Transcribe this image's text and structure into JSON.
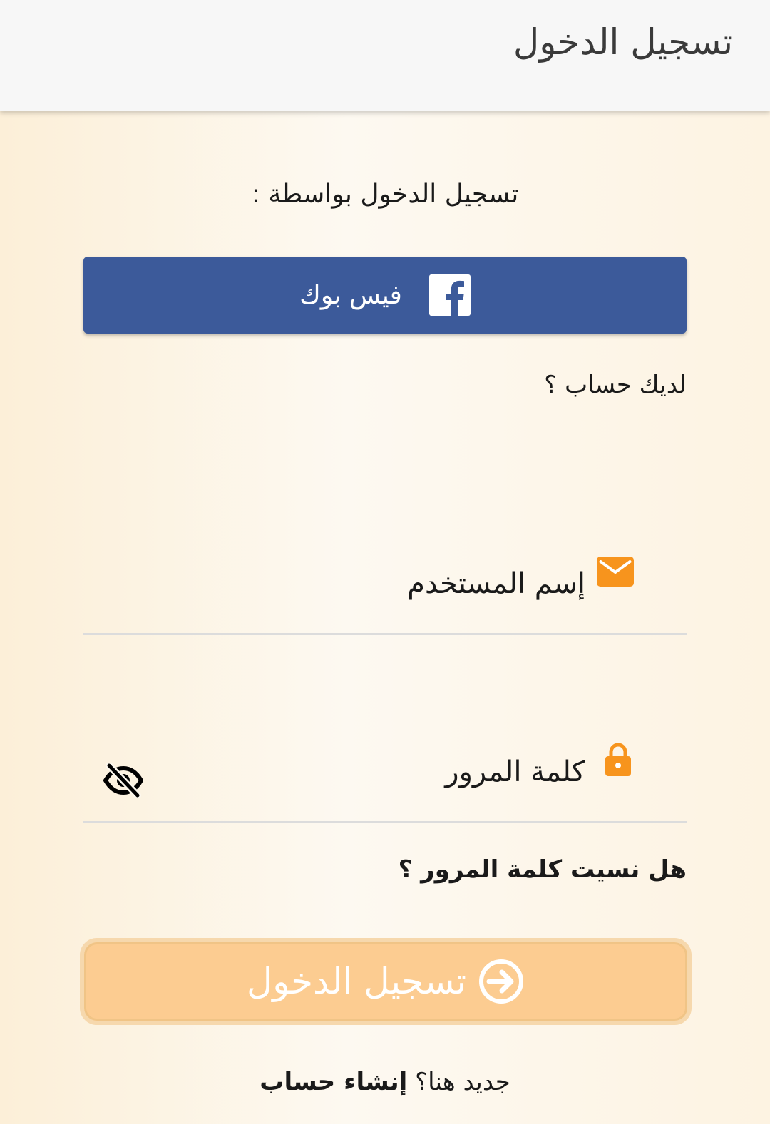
{
  "app_bar": {
    "title": "تسجيل الدخول"
  },
  "login_with_label": "تسجيل الدخول بواسطة :",
  "facebook_button": {
    "label": "فيس بوك",
    "icon": "facebook-icon",
    "color": "#3c5a9a"
  },
  "have_account_label": "لديك حساب ؟",
  "username_field": {
    "placeholder": "إسم المستخدم",
    "icon": "envelope-icon",
    "icon_color": "#f7941d"
  },
  "password_field": {
    "placeholder": "كلمة المرور",
    "icon": "lock-icon",
    "icon_color": "#f7941d",
    "visibility_icon": "eye-off-icon"
  },
  "forgot_password_label": "هل نسيت كلمة المرور ؟",
  "login_button": {
    "label": "تسجيل الدخول",
    "icon": "arrow-right-circle-icon",
    "color": "#fccc91"
  },
  "signup": {
    "prompt": "جديد هنا؟",
    "link": "إنشاء حساب"
  }
}
